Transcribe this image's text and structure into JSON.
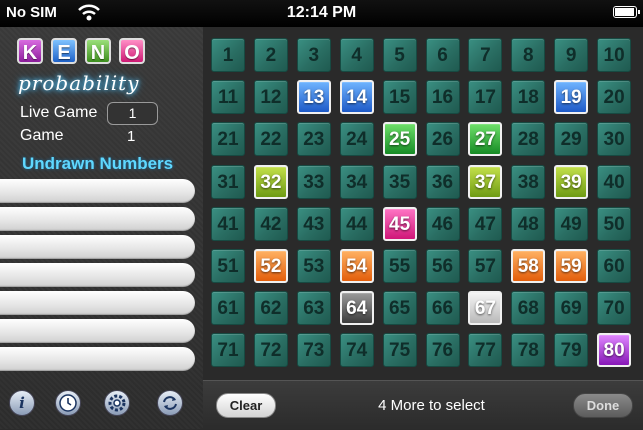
{
  "status_bar": {
    "carrier": "No SIM",
    "time": "12:14 PM"
  },
  "logo": {
    "letters": [
      "K",
      "E",
      "N",
      "O"
    ],
    "subtitle": "probability"
  },
  "info": {
    "live_game_label": "Live Game",
    "live_game_value": "1",
    "game_label": "Game",
    "game_value": "1",
    "undrawn_label": "Undrawn Numbers"
  },
  "grid": {
    "numbers": [
      "1",
      "2",
      "3",
      "4",
      "5",
      "6",
      "7",
      "8",
      "9",
      "10",
      "11",
      "12",
      "13",
      "14",
      "15",
      "16",
      "17",
      "18",
      "19",
      "20",
      "21",
      "22",
      "23",
      "24",
      "25",
      "26",
      "27",
      "28",
      "29",
      "30",
      "31",
      "32",
      "33",
      "34",
      "35",
      "36",
      "37",
      "38",
      "39",
      "40",
      "41",
      "42",
      "43",
      "44",
      "45",
      "46",
      "47",
      "48",
      "49",
      "50",
      "51",
      "52",
      "53",
      "54",
      "55",
      "56",
      "57",
      "58",
      "59",
      "60",
      "61",
      "62",
      "63",
      "64",
      "65",
      "66",
      "67",
      "68",
      "69",
      "70",
      "71",
      "72",
      "73",
      "74",
      "75",
      "76",
      "77",
      "78",
      "79",
      "80"
    ],
    "selected": {
      "13": "blue",
      "14": "blue",
      "19": "blue",
      "25": "green",
      "27": "green",
      "32": "lime",
      "37": "lime",
      "39": "lime",
      "45": "pink",
      "52": "orange",
      "54": "orange",
      "58": "orange",
      "59": "orange",
      "64": "gray",
      "67": "white",
      "80": "purple"
    }
  },
  "bottom_bar": {
    "clear_label": "Clear",
    "message": "4 More to select",
    "done_label": "Done"
  },
  "toolbar_icons": [
    "info-icon",
    "clock-icon",
    "gear-icon",
    "refresh-icon"
  ]
}
